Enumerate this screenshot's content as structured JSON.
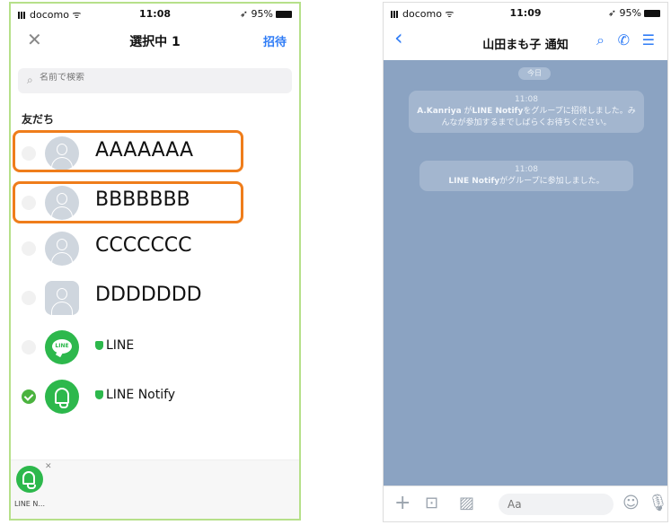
{
  "colors": {
    "accent": "#2f7cf6",
    "line_green": "#2db84c",
    "highlight": "#ef7d1b",
    "chat_bg": "#8ba3c2",
    "frame_green": "#b6e08a"
  },
  "left": {
    "status": {
      "carrier": "docomo",
      "time": "11:08",
      "battery": "95%"
    },
    "nav": {
      "close_icon": "close-icon",
      "title": "選択中 1",
      "invite": "招待"
    },
    "search": {
      "placeholder": "名前で検索"
    },
    "section_title": "友だち",
    "friends": [
      {
        "name": "AAAAAAA",
        "checked": false,
        "icon": "default-avatar"
      },
      {
        "name": "BBBBBBB",
        "checked": false,
        "icon": "default-avatar"
      },
      {
        "name": "CCCCCCC",
        "checked": false,
        "icon": "default-avatar"
      },
      {
        "name": "DDDDDDD",
        "checked": false,
        "icon": "default-avatar"
      },
      {
        "name": "LINE",
        "checked": false,
        "icon": "line-logo-icon"
      },
      {
        "name": "LINE Notify",
        "checked": true,
        "icon": "bell-icon"
      }
    ],
    "selected": {
      "label": "LINE N..."
    }
  },
  "right": {
    "status": {
      "carrier": "docomo",
      "time": "11:09",
      "battery": "95%"
    },
    "nav": {
      "title": "山田まも子 通知",
      "icons": [
        "search-icon",
        "phone-icon",
        "menu-icon"
      ]
    },
    "date_pill": "今日",
    "messages": [
      {
        "time": "11:08",
        "actor": "A.Kanriya",
        "text1": " が",
        "bold": "LINE Notify",
        "text2": "をグループに招待しました。みんなが参加するまでしばらくお待ちください。"
      },
      {
        "time": "11:08",
        "bold": "LINE Notify",
        "text2": "がグループに参加しました。"
      }
    ],
    "composer": {
      "placeholder": "Aa"
    }
  }
}
